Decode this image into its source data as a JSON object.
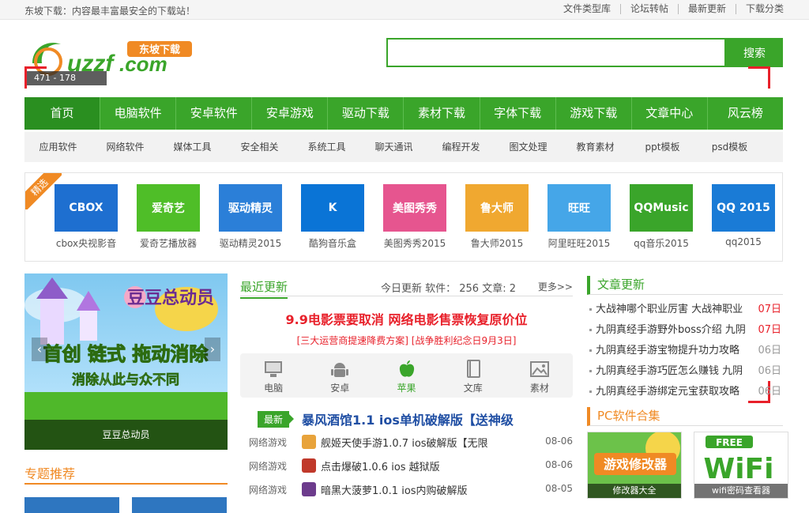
{
  "topbar": {
    "slogan": "东坡下载：内容最丰富最安全的下载站！",
    "links": [
      "文件类型库",
      "论坛转帖",
      "最新更新",
      "下载分类"
    ]
  },
  "logo": {
    "brand_cn": "东坡下载",
    "brand_text": "uzzf.com"
  },
  "coords_readout": "471 - 178",
  "search": {
    "placeholder": "",
    "button": "搜索"
  },
  "main_nav": [
    "首页",
    "电脑软件",
    "安卓软件",
    "安卓游戏",
    "驱动下载",
    "素材下载",
    "字体下载",
    "游戏下载",
    "文章中心",
    "风云榜"
  ],
  "sub_nav": [
    "应用软件",
    "网络软件",
    "媒体工具",
    "安全相关",
    "系统工具",
    "聊天通讯",
    "编程开发",
    "图文处理",
    "教育素材",
    "ppt模板",
    "psd模板"
  ],
  "featured": {
    "tag": "精选",
    "apps": [
      {
        "name": "cbox央视影音",
        "icon_text": "CBOX",
        "color": "#1e6fd0"
      },
      {
        "name": "爱奇艺播放器",
        "icon_text": "爱奇艺",
        "color": "#4fbe28"
      },
      {
        "name": "驱动精灵2015",
        "icon_text": "驱动精灵",
        "color": "#2b7fd8"
      },
      {
        "name": "酷狗音乐盒",
        "icon_text": "K",
        "color": "#0a74d6"
      },
      {
        "name": "美图秀秀2015",
        "icon_text": "美图秀秀",
        "color": "#e6558f"
      },
      {
        "name": "鲁大师2015",
        "icon_text": "鲁大师",
        "color": "#f0a830"
      },
      {
        "name": "阿里旺旺2015",
        "icon_text": "旺旺",
        "color": "#45a6e8"
      },
      {
        "name": "qq音乐2015",
        "icon_text": "QQMusic",
        "color": "#3aa52a"
      },
      {
        "name": "qq2015",
        "icon_text": "QQ 2015",
        "color": "#1a7bd6"
      }
    ]
  },
  "banner": {
    "title_line1": "豆豆总动员",
    "slogan_big": "首创 链式 拖动消除",
    "slogan_small": "消除从此与众不同",
    "caption": "豆豆总动员"
  },
  "topics": {
    "title": "专题推荐"
  },
  "recent": {
    "title": "最近更新",
    "stats": "今日更新 软件： 256 文章: 2",
    "more": "更多>>",
    "headline": "9.9电影票要取消 网络电影售票恢复原价位",
    "subhead_1": "三大运营商提速降费方案",
    "subhead_2": "战争胜利纪念日9月3日",
    "platforms": [
      {
        "label": "电脑",
        "icon": "pc-icon"
      },
      {
        "label": "安卓",
        "icon": "android-icon"
      },
      {
        "label": "苹果",
        "icon": "apple-icon",
        "active": true
      },
      {
        "label": "文库",
        "icon": "book-icon"
      },
      {
        "label": "素材",
        "icon": "image-icon"
      }
    ],
    "newest_badge": "最新",
    "newest_title": "暴风酒馆1.1 ios单机破解版【送神级",
    "rows": [
      {
        "cat": "网络游戏",
        "title": "舰姬天使手游1.0.7 ios破解版【无限",
        "date": "08-06",
        "color": "#e8a33b"
      },
      {
        "cat": "网络游戏",
        "title": "点击爆破1.0.6 ios 越狱版",
        "date": "08-06",
        "color": "#c0392b"
      },
      {
        "cat": "网络游戏",
        "title": "暗黑大菠萝1.0.1 ios内购破解版",
        "date": "08-05",
        "color": "#6c3b8c"
      }
    ]
  },
  "articles": {
    "title": "文章更新",
    "items": [
      {
        "title": "大战神哪个职业厉害 大战神职业",
        "date": "07日",
        "highlight": true
      },
      {
        "title": "九阴真经手游野外boss介绍 九阴",
        "date": "07日",
        "highlight": true
      },
      {
        "title": "九阴真经手游宝物提升功力攻略",
        "date": "06日",
        "highlight": false
      },
      {
        "title": "九阴真经手游巧匠怎么赚钱 九阴",
        "date": "06日",
        "highlight": false
      },
      {
        "title": "九阴真经手游绑定元宝获取攻略",
        "date": "06日",
        "highlight": false
      }
    ]
  },
  "pc_packs": {
    "title": "PC软件合集",
    "items": [
      {
        "icon_text": "游戏修改器",
        "label": "修改器大全"
      },
      {
        "icon_text": "WiFi",
        "badge": "FREE",
        "label": "wifi密码查看器"
      }
    ]
  },
  "colors": {
    "brand_green": "#3aa52a",
    "accent_orange": "#f08a24",
    "accent_red": "#e8202a",
    "link_blue": "#1f4ea3"
  }
}
